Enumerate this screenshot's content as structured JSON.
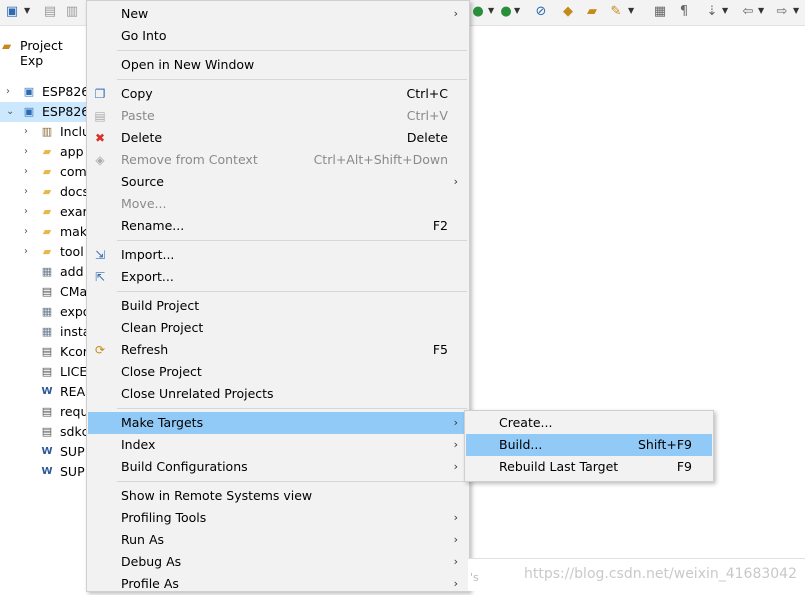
{
  "explorer": {
    "title": "Project Exp",
    "items": [
      {
        "label": "ESP826",
        "icon": "project-icon",
        "twisty": "collapsed"
      },
      {
        "label": "ESP826",
        "icon": "project-icon",
        "twisty": "expanded",
        "selected": true
      },
      {
        "label": "Inclu",
        "icon": "includes-icon",
        "twisty": "collapsed"
      },
      {
        "label": "app",
        "icon": "folder-icon",
        "twisty": "collapsed"
      },
      {
        "label": "com",
        "icon": "folder-icon",
        "twisty": "collapsed"
      },
      {
        "label": "docs",
        "icon": "folder-icon",
        "twisty": "collapsed"
      },
      {
        "label": "exar",
        "icon": "folder-icon",
        "twisty": "collapsed"
      },
      {
        "label": "mak",
        "icon": "folder-icon",
        "twisty": "collapsed"
      },
      {
        "label": "tool",
        "icon": "folder-icon",
        "twisty": "collapsed"
      },
      {
        "label": "add",
        "icon": "script-file-icon",
        "twisty": ""
      },
      {
        "label": "CMa",
        "icon": "file-icon",
        "twisty": ""
      },
      {
        "label": "expo",
        "icon": "script-file-icon",
        "twisty": ""
      },
      {
        "label": "insta",
        "icon": "script-file-icon",
        "twisty": ""
      },
      {
        "label": "Kcor",
        "icon": "file-icon",
        "twisty": ""
      },
      {
        "label": "LICE",
        "icon": "file-icon",
        "twisty": ""
      },
      {
        "label": "REA",
        "icon": "word-file-icon",
        "twisty": ""
      },
      {
        "label": "requ",
        "icon": "file-icon",
        "twisty": ""
      },
      {
        "label": "sdkc",
        "icon": "file-icon",
        "twisty": ""
      },
      {
        "label": "SUP",
        "icon": "word-file-icon",
        "twisty": ""
      },
      {
        "label": "SUP",
        "icon": "word-file-icon",
        "twisty": ""
      }
    ]
  },
  "menu": {
    "items": {
      "new": {
        "label": "New",
        "submenu": "›"
      },
      "go_into": {
        "label": "Go Into"
      },
      "open_new_window": {
        "label": "Open in New Window"
      },
      "copy": {
        "label": "Copy",
        "shortcut": "Ctrl+C"
      },
      "paste": {
        "label": "Paste",
        "shortcut": "Ctrl+V"
      },
      "delete": {
        "label": "Delete",
        "shortcut": "Delete"
      },
      "remove_context": {
        "label": "Remove from Context",
        "shortcut": "Ctrl+Alt+Shift+Down"
      },
      "source": {
        "label": "Source",
        "submenu": "›"
      },
      "move": {
        "label": "Move..."
      },
      "rename": {
        "label": "Rename...",
        "shortcut": "F2"
      },
      "import": {
        "label": "Import..."
      },
      "export": {
        "label": "Export..."
      },
      "build_project": {
        "label": "Build Project"
      },
      "clean_project": {
        "label": "Clean Project"
      },
      "refresh": {
        "label": "Refresh",
        "shortcut": "F5"
      },
      "close_project": {
        "label": "Close Project"
      },
      "close_unrelated": {
        "label": "Close Unrelated Projects"
      },
      "make_targets": {
        "label": "Make Targets",
        "submenu": "›"
      },
      "index": {
        "label": "Index",
        "submenu": "›"
      },
      "build_configurations": {
        "label": "Build Configurations",
        "submenu": "›"
      },
      "remote_systems": {
        "label": "Show in Remote Systems view"
      },
      "profiling_tools": {
        "label": "Profiling Tools",
        "submenu": "›"
      },
      "run_as": {
        "label": "Run As",
        "submenu": "›"
      },
      "debug_as": {
        "label": "Debug As",
        "submenu": "›"
      },
      "profile_as": {
        "label": "Profile As",
        "submenu": "›"
      }
    }
  },
  "submenu": {
    "create": {
      "label": "Create..."
    },
    "build": {
      "label": "Build...",
      "shortcut": "Shift+F9"
    },
    "rebuild_last": {
      "label": "Rebuild Last Target",
      "shortcut": "F9"
    }
  },
  "watermark": "https://blog.csdn.net/weixin_41683042",
  "faded_text": "'s",
  "colors": {
    "highlight": "#91c9f7",
    "selection": "#cce8ff",
    "menu_bg": "#f2f2f2",
    "delete_red": "#d9302c",
    "folder_yellow": "#e8b84a"
  }
}
